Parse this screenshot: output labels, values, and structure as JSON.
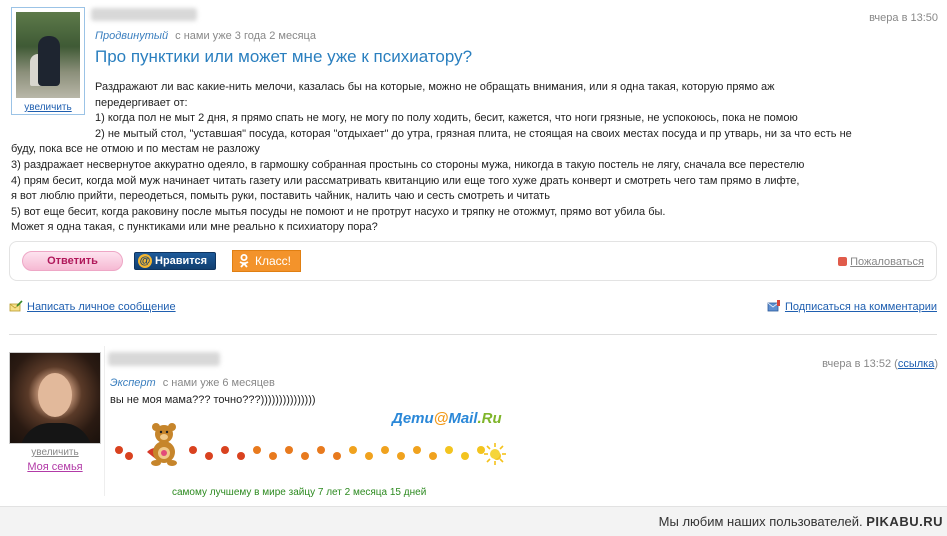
{
  "post": {
    "rank": "Продвинутый",
    "member_since": "с нами уже 3 года 2 месяца",
    "timestamp": "вчера в 13:50",
    "avatar_zoom": "увеличить",
    "title": "Про пунктики или может мне уже к психиатору?",
    "body_lines": [
      "Раздражают ли вас какие-нить мелочи, казалась бы на которые, можно не обращать внимания, или я одна такая, которую прямо аж",
      "передергивает от:",
      "1) когда пол не мыт 2 дня, я прямо спать не могу, не могу по полу ходить, бесит, кажется, что ноги грязные, не успокоюсь, пока не помою",
      "2) не мытый стол, \"уставшая\" посуда, которая \"отдыхает\" до утра, грязная плита, не стоящая на своих местах посуда и пр утварь, ни за что есть не",
      "буду, пока все не отмою и по местам не разложу",
      "3) раздражает несвернутое аккуратно одеяло, в гармошку собранная простынь со стороны мужа, никогда в такую постель не лягу, сначала все перестелю",
      "4) прям бесит, когда мой муж начинает читать газету или рассматривать квитанцию или еще того хуже драть конверт и смотреть чего там прямо в лифте,",
      "я вот люблю прийти, переодеться, помыть руки, поставить чайник, налить чаю и сесть смотреть и читать",
      "5) вот еще бесит, когда раковину после мытья посуды не помоют и не протрут насухо и тряпку не отожмут, прямо вот убила бы.",
      "Может я одна такая, с пунктиками или мне реально к психиатору пора?"
    ]
  },
  "actions": {
    "reply": "Ответить",
    "like": "Нравится",
    "ok": "Класс!",
    "complain": "Пожаловаться"
  },
  "links": {
    "private_message": "Написать личное сообщение",
    "subscribe": "Подписаться на комментарии"
  },
  "comment": {
    "rank": "Эксперт",
    "member_since": "с нами уже 6 месяцев",
    "timestamp": "вчера в 13:52",
    "link_label": "ссылка",
    "text": "вы не моя мама??? точно???)))))))))))))))",
    "avatar_zoom": "увеличить",
    "family_link": "Моя семья",
    "logo_main": "Дети",
    "logo_at": "@",
    "logo_mail": "Mail",
    "logo_ru": ".Ru",
    "kid_caption": "самому лучшему в мире зайцу 7 лет 2 месяца 15 дней"
  },
  "footer": {
    "text": "Мы любим наших пользователей.",
    "brand": "PIKABU.RU"
  },
  "colors": {
    "title": "#2a7fbf",
    "link": "#1f5fb0",
    "rank": "#3b7fbf",
    "reply_button": "#f6b9d3",
    "like_button": "#123f70",
    "ok_button": "#f3932b",
    "caption_green": "#2c8a1f"
  },
  "icons": {
    "message": "envelope-pencil-icon",
    "subscribe": "subscribe-icon",
    "complain": "flag-icon",
    "ok": "odnoklassniki-icon",
    "like": "mail-at-icon"
  }
}
